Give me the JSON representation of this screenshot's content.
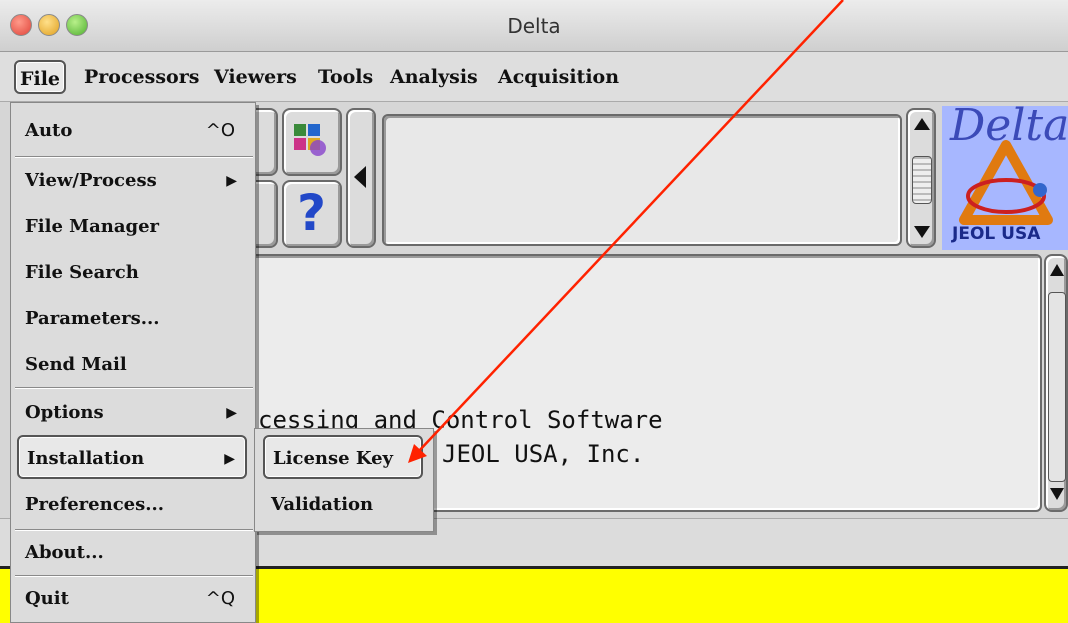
{
  "window": {
    "title": "Delta"
  },
  "menubar": {
    "items": [
      "File",
      "Processors",
      "Viewers",
      "Tools",
      "Analysis",
      "Acquisition"
    ]
  },
  "file_menu": {
    "items": [
      {
        "label": "Auto",
        "shortcut": "^O"
      },
      {
        "label": "View/Process",
        "submenu": true
      },
      {
        "label": "File Manager"
      },
      {
        "label": "File Search"
      },
      {
        "label": "Parameters..."
      },
      {
        "label": "Send Mail"
      },
      {
        "label": "Options",
        "submenu": true
      },
      {
        "label": "Installation",
        "submenu": true,
        "highlighted": true
      },
      {
        "label": "Preferences..."
      },
      {
        "label": "About..."
      },
      {
        "label": "Quit",
        "shortcut": "^Q"
      }
    ]
  },
  "installation_submenu": {
    "items": [
      {
        "label": "License Key",
        "highlighted": true
      },
      {
        "label": "Validation"
      }
    ]
  },
  "console": {
    "line1": "cessing and Control Software",
    "line2": "JEOL USA, Inc."
  },
  "logo": {
    "title": "Delta",
    "brand": "JEOL USA"
  },
  "toolbar": {
    "help_glyph": "?"
  },
  "colors": {
    "status_bar": "#ffff00",
    "annotation_arrow": "#ff2200"
  }
}
